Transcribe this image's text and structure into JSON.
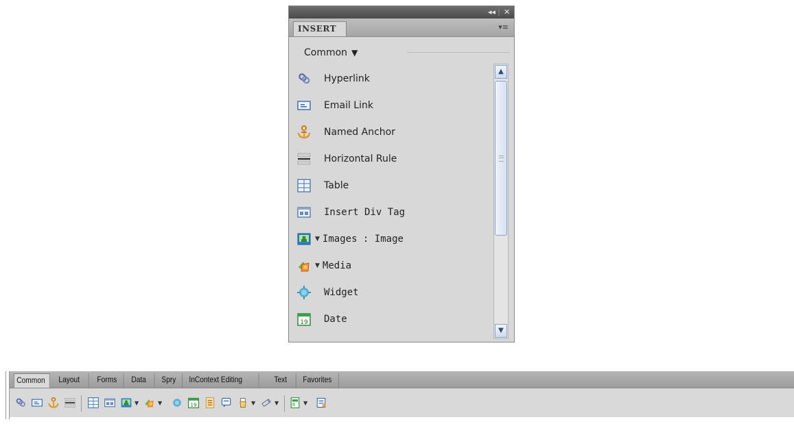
{
  "panel": {
    "title": "INSERT",
    "collapse_glyph": "◂◂",
    "close_glyph": "✕",
    "menu_glyph": "▾≡",
    "category": "Common",
    "items": [
      {
        "label": "Hyperlink",
        "icon": "hyperlink-icon"
      },
      {
        "label": "Email Link",
        "icon": "email-link-icon"
      },
      {
        "label": "Named Anchor",
        "icon": "named-anchor-icon"
      },
      {
        "label": "Horizontal Rule",
        "icon": "horizontal-rule-icon"
      },
      {
        "label": "Table",
        "icon": "table-icon"
      },
      {
        "label": "Insert Div Tag",
        "icon": "insert-div-tag-icon"
      },
      {
        "label": "Images : Image",
        "icon": "image-icon"
      },
      {
        "label": "Media",
        "icon": "media-icon"
      },
      {
        "label": "Widget",
        "icon": "widget-icon"
      },
      {
        "label": "Date",
        "icon": "date-icon"
      }
    ]
  },
  "insert_bar": {
    "tabs": [
      "Common",
      "Layout",
      "Forms",
      "Data",
      "Spry",
      "InContext Editing",
      "Text",
      "Favorites"
    ],
    "active_tab": "Common"
  },
  "colors": {
    "panel_bg": "#d8d8d8",
    "titlebar": "#4a4a4a",
    "scroll_accent": "#8aa2c8"
  }
}
